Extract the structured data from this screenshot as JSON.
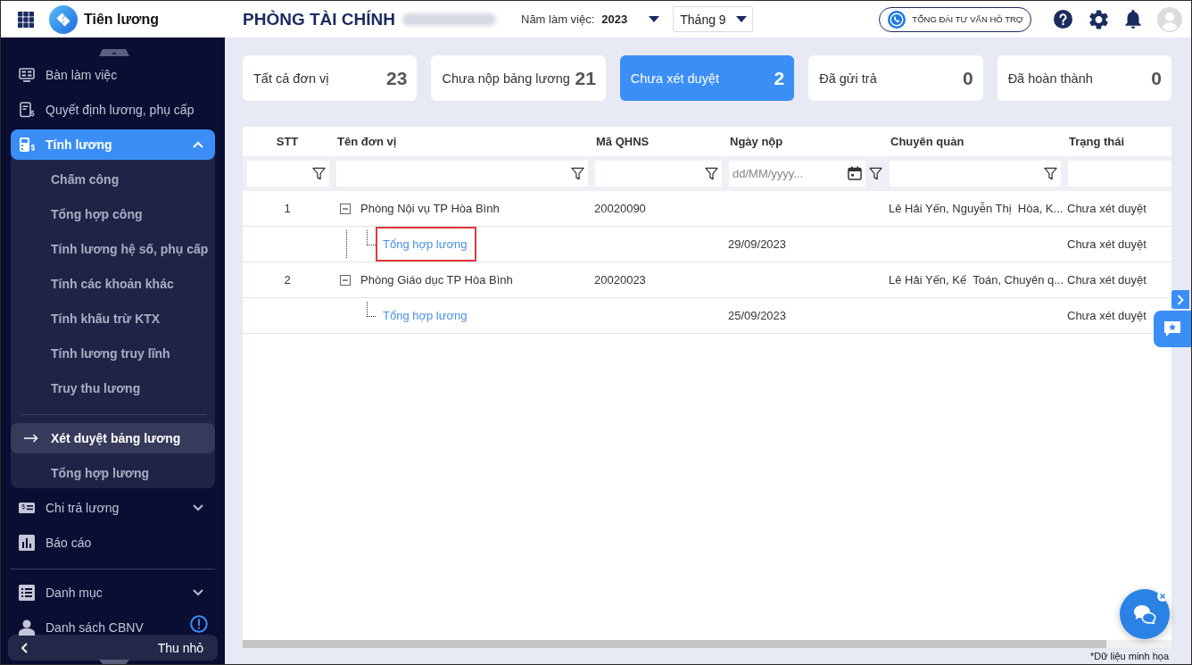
{
  "app": {
    "name": "Tiên lương"
  },
  "header": {
    "title": "PHÒNG TÀI CHÍNH",
    "year_label": "Năm làm việc:",
    "year": "2023",
    "month": "Tháng 9",
    "support_button": "TỔNG ĐÀI TƯ VẤN HỖ TRỢ"
  },
  "sidebar": {
    "items": [
      {
        "label": "Bàn làm việc",
        "selected": false,
        "divider_before": false
      },
      {
        "label": "Quyết định lương, phụ cấp",
        "selected": false,
        "divider_before": false
      },
      {
        "label": "Tính lương",
        "selected": true,
        "divider_before": false,
        "expanded": true,
        "children": [
          {
            "label": "Chấm công",
            "selected": false,
            "divider_before": false
          },
          {
            "label": "Tổng hợp công",
            "selected": false,
            "divider_before": false
          },
          {
            "label": "Tính lương hệ số, phụ cấp",
            "selected": false,
            "divider_before": false
          },
          {
            "label": "Tính các khoản khác",
            "selected": false,
            "divider_before": false
          },
          {
            "label": "Tính khấu trừ KTX",
            "selected": false,
            "divider_before": false
          },
          {
            "label": "Tính lương truy lĩnh",
            "selected": false,
            "divider_before": false
          },
          {
            "label": "Truy thu lương",
            "selected": false,
            "divider_before": false
          },
          {
            "label": "Xét duyệt bảng lương",
            "selected": true,
            "divider_before": true
          },
          {
            "label": "Tổng hợp lương",
            "selected": false,
            "divider_before": false
          }
        ]
      },
      {
        "label": "Chi trả lương",
        "selected": false,
        "divider_before": false,
        "expanded": false
      },
      {
        "label": "Báo cáo",
        "selected": false,
        "divider_before": false
      },
      {
        "label": "Danh mục",
        "selected": false,
        "divider_before": true,
        "expanded": false
      },
      {
        "label": "Danh sách CBNV",
        "selected": false,
        "divider_before": false
      }
    ],
    "collapse_button": "Thu nhỏ"
  },
  "status_cards": [
    {
      "label": "Tất cả đơn vị",
      "count": "23",
      "selected": false
    },
    {
      "label": "Chưa nộp bảng lương",
      "count": "21",
      "selected": false
    },
    {
      "label": "Chưa xét duyệt",
      "count": "2",
      "selected": true
    },
    {
      "label": "Đã gửi trả",
      "count": "0",
      "selected": false
    },
    {
      "label": "Đã hoàn thành",
      "count": "0",
      "selected": false
    }
  ],
  "table": {
    "columns": [
      {
        "label": "STT",
        "filter": {
          "kind": "text"
        }
      },
      {
        "label": "Tên đơn vị",
        "filter": {
          "kind": "text"
        }
      },
      {
        "label": "Mã QHNS",
        "filter": {
          "kind": "text"
        }
      },
      {
        "label": "Ngày nộp",
        "filter": {
          "kind": "date",
          "placeholder": "dd/MM/yyyy..."
        }
      },
      {
        "label": "Chuyên quản",
        "filter": {
          "kind": "text"
        }
      },
      {
        "label": "Trạng thái",
        "filter": {
          "kind": "plain"
        }
      }
    ],
    "rows": [
      {
        "stt": "1",
        "unit": "Phòng Nội vụ TP Hòa Bình",
        "qhns": "20020090",
        "manager": "Lê Hải Yến, Nguyễn Thị  Hòa, K...",
        "status": "Chưa xét duyệt",
        "expanded": true,
        "children": [
          {
            "unit": "Tổng hợp lương",
            "submitted": "29/09/2023",
            "status": "Chưa xét duyệt",
            "highlighted": true
          }
        ]
      },
      {
        "stt": "2",
        "unit": "Phòng Giáo dục TP Hòa Bình",
        "qhns": "20020023",
        "manager": "Lê Hải Yến, Kế  Toán, Chuyên q...",
        "status": "Chưa xét duyệt",
        "expanded": true,
        "children": [
          {
            "unit": "Tổng hợp lương",
            "submitted": "25/09/2023",
            "status": "Chưa xét duyệt",
            "highlighted": false
          }
        ]
      }
    ]
  },
  "footnote": "*Dữ liệu minh họa"
}
